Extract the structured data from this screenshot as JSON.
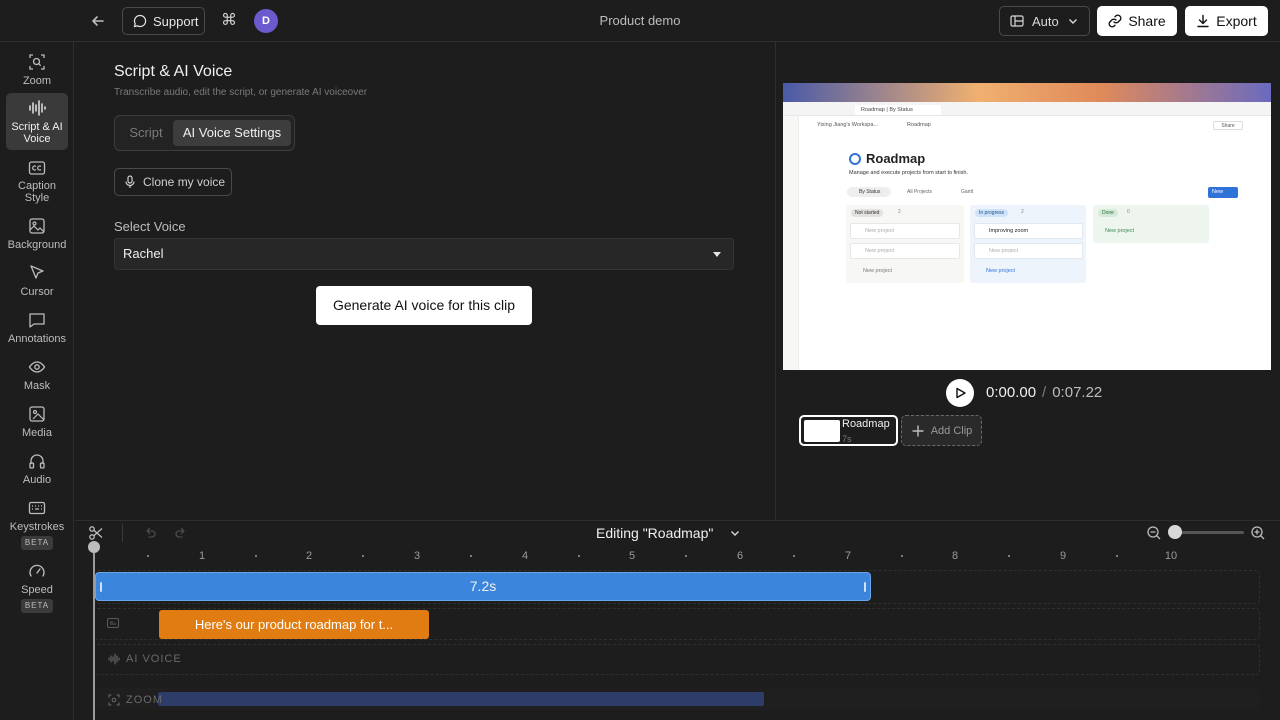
{
  "topbar": {
    "support_label": "Support",
    "avatar_initial": "D",
    "title": "Product demo",
    "auto_label": "Auto",
    "share_label": "Share",
    "export_label": "Export"
  },
  "sidebar": {
    "items": [
      {
        "label": "Zoom",
        "icon": "zoom-icon"
      },
      {
        "label": "Script & AI Voice",
        "icon": "voice-waveform-icon"
      },
      {
        "label": "Caption Style",
        "icon": "caption-icon"
      },
      {
        "label": "Background",
        "icon": "image-icon"
      },
      {
        "label": "Cursor",
        "icon": "cursor-icon"
      },
      {
        "label": "Annotations",
        "icon": "comment-icon"
      },
      {
        "label": "Mask",
        "icon": "eye-icon"
      },
      {
        "label": "Media",
        "icon": "media-icon"
      },
      {
        "label": "Audio",
        "icon": "headphones-icon"
      },
      {
        "label": "Keystrokes",
        "icon": "keyboard-icon",
        "badge": "BETA"
      },
      {
        "label": "Speed",
        "icon": "speedometer-icon",
        "badge": "BETA"
      }
    ]
  },
  "panel": {
    "title": "Script & AI Voice",
    "subtitle": "Transcribe audio, edit the script, or generate AI voiceover",
    "tabs": [
      "Script",
      "AI Voice Settings"
    ],
    "active_tab": "AI Voice Settings",
    "clone_label": "Clone my voice",
    "select_label": "Select Voice",
    "select_value": "Rachel",
    "generate_label": "Generate AI voice for this clip"
  },
  "preview": {
    "screen": {
      "tab_text": "Roadmap | By Status",
      "workspace": "Yixing Jiang's Workspa...",
      "breadcrumb_page": "Roadmap",
      "share_text": "Share",
      "heading": "Roadmap",
      "description": "Manage and execute projects from start to finish.",
      "views": [
        "By Status",
        "All Projects",
        "Gantt"
      ],
      "new_label": "New",
      "columns": [
        {
          "status": "Not started",
          "count": "2",
          "cards": [
            "New project",
            "New project"
          ],
          "add": "New project"
        },
        {
          "status": "In progress",
          "count": "2",
          "cards": [
            "Improving zoom",
            "New project"
          ],
          "add": "New project"
        },
        {
          "status": "Done",
          "count": "0",
          "cards": [],
          "add": "New project"
        }
      ]
    },
    "time_current": "0:00.00",
    "time_separator": "/",
    "time_total": "0:07.22",
    "clip_name": "Roadmap",
    "clip_length": "7s",
    "add_clip_label": "Add Clip"
  },
  "timeline": {
    "editing_label": "Editing \"Roadmap\"",
    "ruler": [
      "1",
      "2",
      "3",
      "4",
      "5",
      "6",
      "7",
      "8",
      "9",
      "10"
    ],
    "main_clip_label": "7.2s",
    "caption_text": "Here's our product roadmap for t...",
    "ai_voice_label": "AI VOICE",
    "zoom_label": "ZOOM"
  },
  "colors": {
    "accent_blue": "#3b86dc",
    "caption_orange": "#e07c12",
    "zoom_track": "#2e3c6a",
    "avatar": "#6a5acd"
  }
}
